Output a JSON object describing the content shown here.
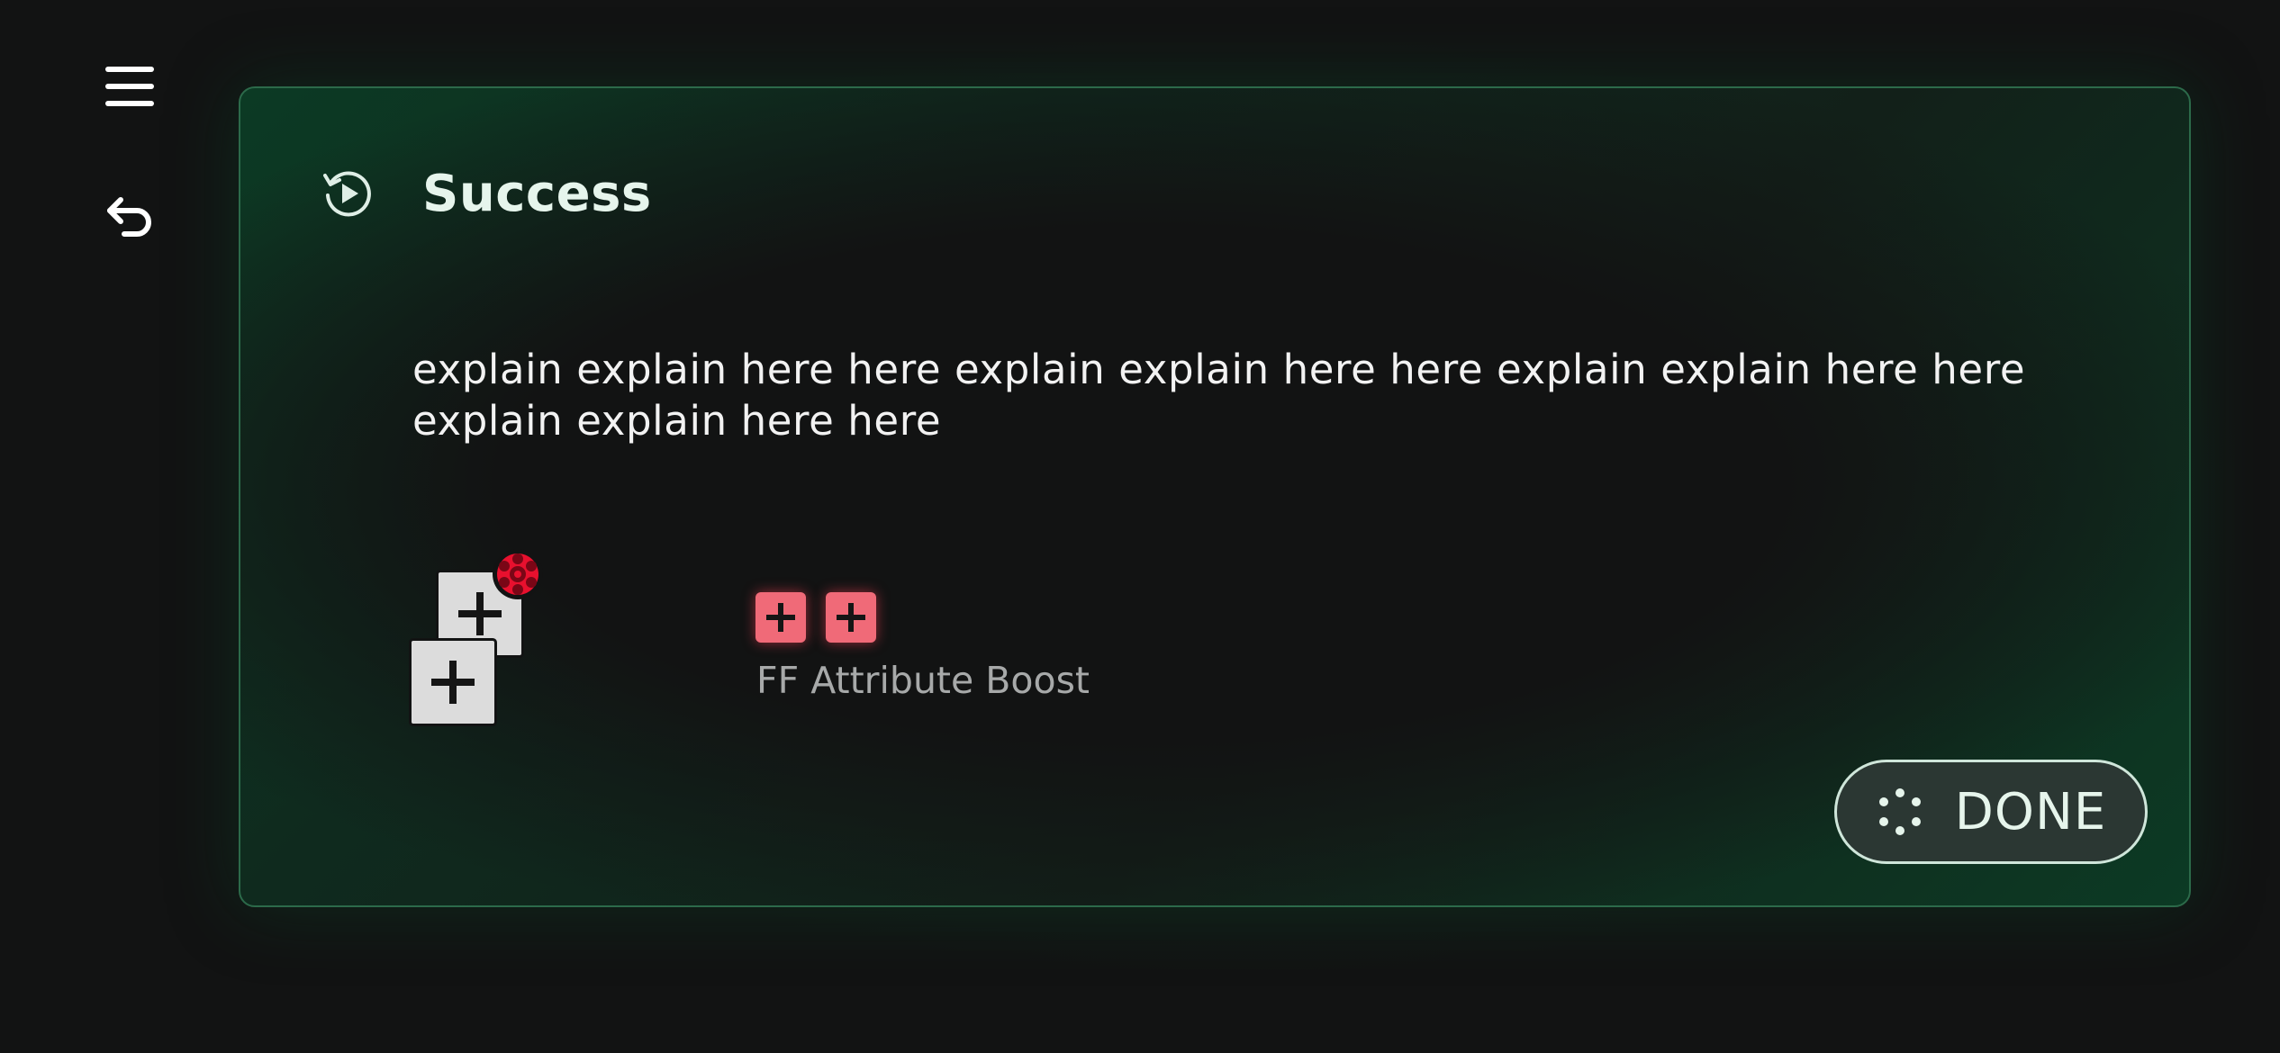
{
  "nav": {
    "menu_icon": "hamburger-menu-icon",
    "back_icon": "return-arrow-icon"
  },
  "dialog": {
    "title": "Success",
    "title_icon": "replay-icon",
    "description": "explain explain here here explain explain here here explain explain here here explain explain here here",
    "reward": {
      "name": "FF Attribute Boost",
      "item_icon": "stacked-plus-cards-icon",
      "gem_icon": "red-gem-icon",
      "badges": [
        "plus-badge-icon",
        "plus-badge-icon"
      ]
    },
    "done_label": "DONE",
    "done_icon": "dots-circle-icon"
  },
  "colors": {
    "background": "#121313",
    "accent_green": "#0c3a24",
    "panel_border": "#2c6a4a",
    "badge_red": "#f06a78",
    "gem_red": "#e8102e"
  }
}
